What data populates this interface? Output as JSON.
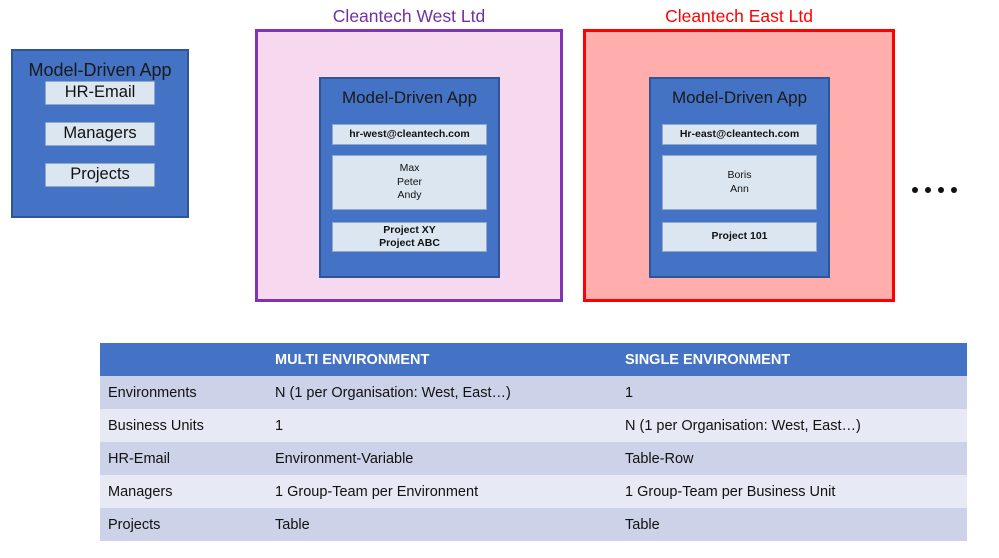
{
  "left_app": {
    "title": "Model-Driven App",
    "items": [
      {
        "label": "HR-Email"
      },
      {
        "label": "Managers"
      },
      {
        "label": "Projects"
      }
    ]
  },
  "orgs": [
    {
      "name": "Cleantech West Ltd",
      "accent": "#7030a0",
      "fill": "#f7d9ef",
      "app": {
        "title": "Model-Driven App",
        "email": "hr-west@cleantech.com",
        "people": [
          "Max",
          "Peter",
          "Andy"
        ],
        "projects": [
          "Project XY",
          "Project ABC"
        ]
      }
    },
    {
      "name": "Cleantech East Ltd",
      "accent": "#ff0000",
      "fill": "#ffadad",
      "app": {
        "title": "Model-Driven App",
        "email": "Hr-east@cleantech.com",
        "people": [
          "Boris",
          "Ann"
        ],
        "projects": [
          "Project 101"
        ]
      }
    }
  ],
  "more_orgs_indicator": "• • • •",
  "comparison": {
    "header": [
      "",
      "MULTI ENVIRONMENT",
      "SINGLE ENVIRONMENT"
    ],
    "rows": [
      {
        "label": "Environments",
        "multi": "N (1 per Organisation: West, East…)",
        "single": "1"
      },
      {
        "label": "Business Units",
        "multi": "1",
        "single": "N (1 per Organisation: West, East…)"
      },
      {
        "label": "HR-Email",
        "multi": "Environment-Variable",
        "single": "Table-Row"
      },
      {
        "label": "Managers",
        "multi": "1 Group-Team per Environment",
        "single": "1 Group-Team per Business Unit"
      },
      {
        "label": "Projects",
        "multi": "Table",
        "single": "Table"
      }
    ]
  },
  "colors": {
    "app_blue": "#4472c4",
    "app_blue_border": "#2f5597",
    "chip_fill": "#dce6f1",
    "table_header": "#4472c4",
    "table_row_odd": "#ccd2e8",
    "table_row_even": "#e7eaf4",
    "west_accent": "#7030a0",
    "east_accent": "#ff0000"
  }
}
